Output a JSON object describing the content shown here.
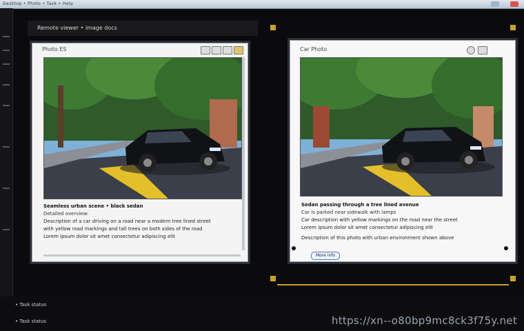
{
  "titlebar": {
    "text": "Desktop • Photo • Task • Help"
  },
  "desktop": {
    "title": "Remote viewer • image docs"
  },
  "left_window": {
    "title": "Photo ES",
    "caption_heading": "Seamless urban scene • black sedan",
    "caption_sub": "Detailed overview:",
    "caption_lines": [
      "Description of a car driving on a road near a modern tree lined street",
      "with yellow road markings and tall trees on both sides of the road",
      "Lorem ipsum dolor sit amet consectetur adipiscing elit"
    ]
  },
  "right_window": {
    "title": "Car Photo",
    "caption_heading": "Sedan passing through a tree lined avenue",
    "caption_sub": "Car is parked near sidewalk with lamps",
    "caption_lines": [
      "Car description with yellow markings on the road near the street",
      "Lorem ipsum dolor sit amet consectetur adipiscing elit"
    ],
    "caption_footer": "Description of this photo with urban environment shown above",
    "link_pill": "More info"
  },
  "status": {
    "line1": "• Task status",
    "line2": "• Task status"
  },
  "watermark": "https://xn--o80bp9mc8ck3f75y.net",
  "colors": {
    "accent_yellow": "#c9a227",
    "window_frame": "#2b2e33"
  }
}
